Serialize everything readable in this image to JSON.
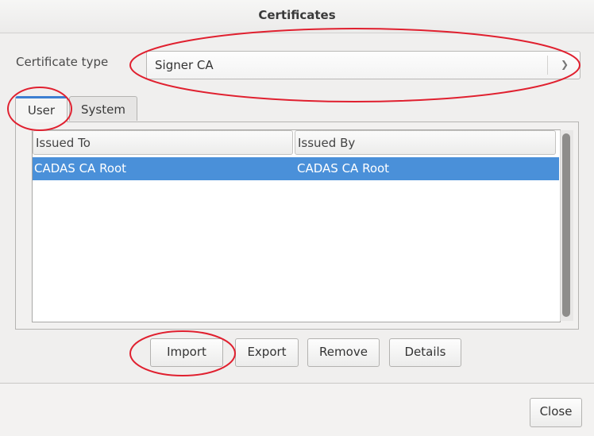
{
  "window": {
    "title": "Certificates"
  },
  "certificate_type": {
    "label": "Certificate type",
    "selected": "Signer CA",
    "arrow_icon": "chevron-down-icon"
  },
  "tabs": [
    {
      "label": "User",
      "active": true
    },
    {
      "label": "System",
      "active": false
    }
  ],
  "table": {
    "columns": [
      "Issued To",
      "Issued By"
    ],
    "rows": [
      {
        "issued_to": "CADAS CA Root",
        "issued_by": "CADAS CA Root",
        "selected": true
      }
    ]
  },
  "buttons": {
    "import": {
      "pre": "",
      "mnemonic": "I",
      "post": "mport"
    },
    "export": {
      "pre": "",
      "mnemonic": "E",
      "post": "xport"
    },
    "remove": {
      "pre": "Re",
      "mnemonic": "m",
      "post": "ove"
    },
    "details": {
      "pre": "",
      "mnemonic": "D",
      "post": "etails"
    },
    "close": "Close"
  },
  "colors": {
    "selection": "#4a90d9",
    "annotation": "#e0202f"
  }
}
